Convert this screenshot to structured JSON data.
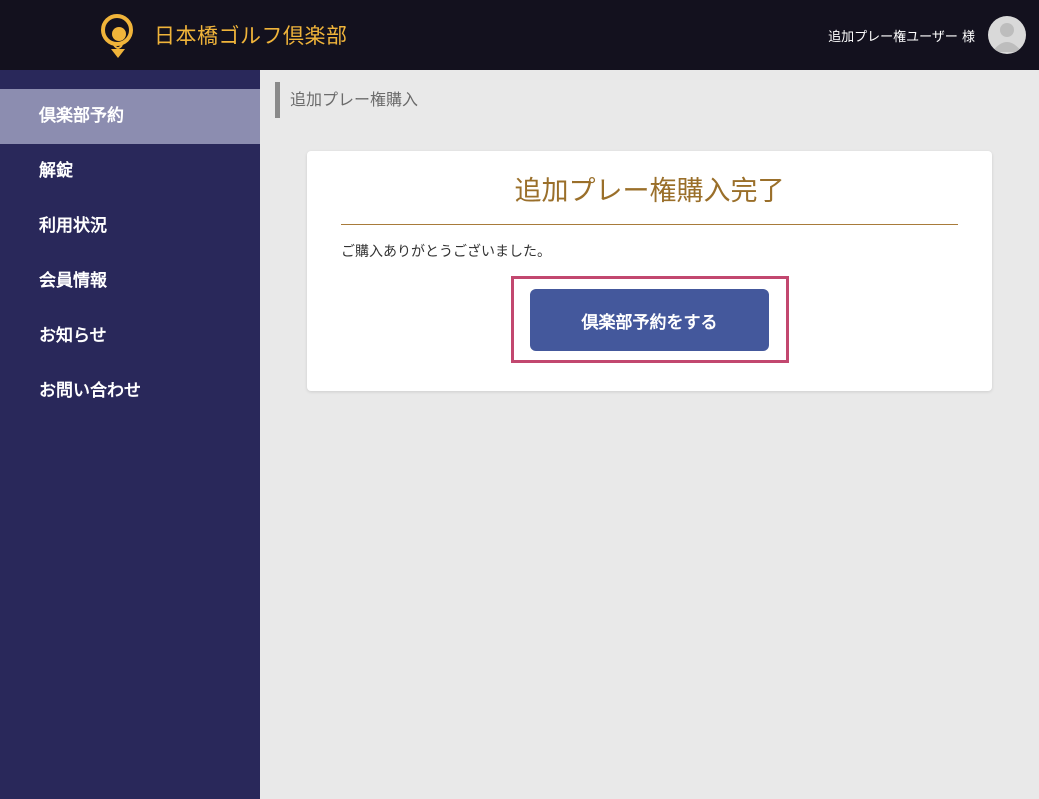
{
  "header": {
    "brand": "日本橋ゴルフ倶楽部",
    "user_name": "追加プレー権ユーザー 様",
    "brand_color": "#f0b43a",
    "background_color": "#13111e"
  },
  "sidebar": {
    "background_color": "#29285a",
    "active_color": "#8c8db0",
    "items": [
      {
        "label": "倶楽部予約",
        "active": true
      },
      {
        "label": "解錠",
        "active": false
      },
      {
        "label": "利用状況",
        "active": false
      },
      {
        "label": "会員情報",
        "active": false
      },
      {
        "label": "お知らせ",
        "active": false
      },
      {
        "label": "お問い合わせ",
        "active": false
      }
    ]
  },
  "main": {
    "breadcrumb": "追加プレー権購入",
    "card": {
      "title": "追加プレー権購入完了",
      "message": "ご購入ありがとうございました。",
      "button_label": "倶楽部予約をする",
      "button_color": "#44589c",
      "highlight_color": "#c2476f"
    }
  },
  "icons": {
    "logo": "golf-ball-logo-icon",
    "avatar": "user-avatar-icon"
  }
}
